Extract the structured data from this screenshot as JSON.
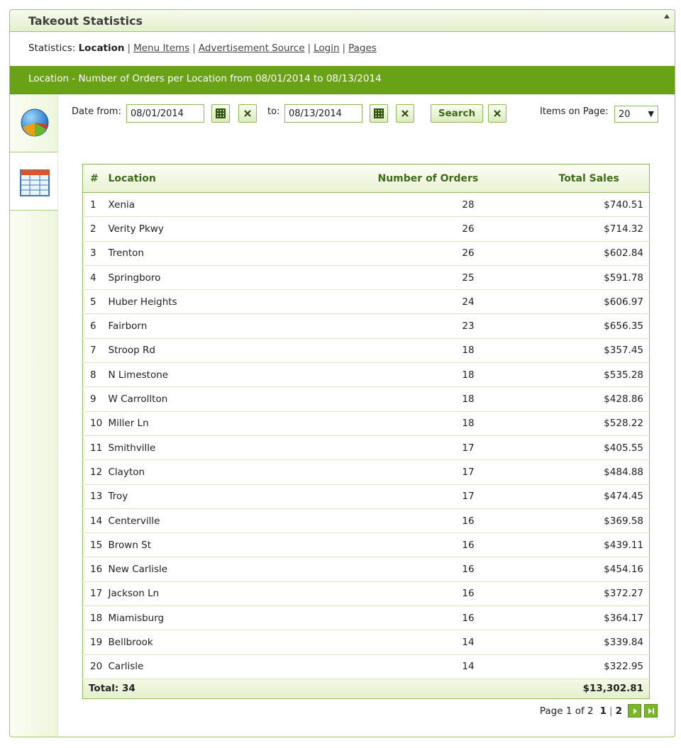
{
  "panel": {
    "title": "Takeout Statistics"
  },
  "nav": {
    "prefix": "Statistics:",
    "current": "Location",
    "links": [
      "Menu Items",
      "Advertisement Source",
      "Login",
      "Pages"
    ]
  },
  "banner": {
    "text": "Location - Number of Orders per Location from 08/01/2014 to 08/13/2014"
  },
  "filters": {
    "date_from_label": "Date from:",
    "date_from": "08/01/2014",
    "to_label": "to:",
    "date_to": "08/13/2014",
    "search_label": "Search",
    "items_label": "Items on Page:",
    "items_value": "20"
  },
  "table": {
    "headers": [
      "#",
      "Location",
      "Number of Orders",
      "Total Sales"
    ],
    "rows": [
      [
        "1",
        "Xenia",
        "28",
        "$740.51"
      ],
      [
        "2",
        "Verity Pkwy",
        "26",
        "$714.32"
      ],
      [
        "3",
        "Trenton",
        "26",
        "$602.84"
      ],
      [
        "4",
        "Springboro",
        "25",
        "$591.78"
      ],
      [
        "5",
        "Huber Heights",
        "24",
        "$606.97"
      ],
      [
        "6",
        "Fairborn",
        "23",
        "$656.35"
      ],
      [
        "7",
        "Stroop Rd",
        "18",
        "$357.45"
      ],
      [
        "8",
        "N Limestone",
        "18",
        "$535.28"
      ],
      [
        "9",
        "W Carrollton",
        "18",
        "$428.86"
      ],
      [
        "10",
        "Miller Ln",
        "18",
        "$528.22"
      ],
      [
        "11",
        "Smithville",
        "17",
        "$405.55"
      ],
      [
        "12",
        "Clayton",
        "17",
        "$484.88"
      ],
      [
        "13",
        "Troy",
        "17",
        "$474.45"
      ],
      [
        "14",
        "Centerville",
        "16",
        "$369.58"
      ],
      [
        "15",
        "Brown St",
        "16",
        "$439.11"
      ],
      [
        "16",
        "New Carlisle",
        "16",
        "$454.16"
      ],
      [
        "17",
        "Jackson Ln",
        "16",
        "$372.27"
      ],
      [
        "18",
        "Miamisburg",
        "16",
        "$364.17"
      ],
      [
        "19",
        "Bellbrook",
        "14",
        "$339.84"
      ],
      [
        "20",
        "Carlisle",
        "14",
        "$322.95"
      ]
    ],
    "total_label": "Total: 34",
    "total_sales": "$13,302.81"
  },
  "pager": {
    "text": "Page 1 of 2",
    "pages": [
      "1",
      "2"
    ]
  },
  "colors": {
    "accent": "#6aa217",
    "border": "#8cb95a",
    "header_text": "#3f6a1a"
  }
}
